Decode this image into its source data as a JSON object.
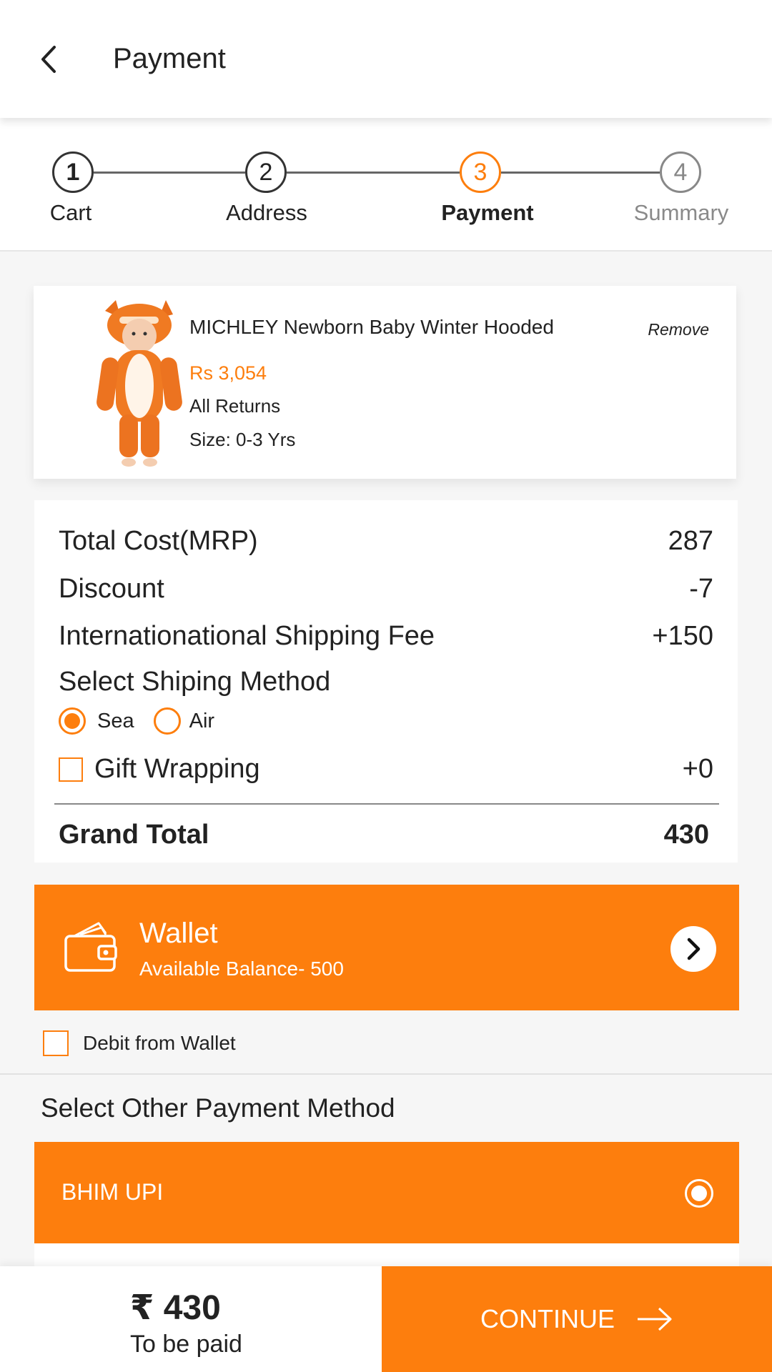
{
  "header": {
    "title": "Payment",
    "back_icon": "chevron-left-icon"
  },
  "stepper": {
    "steps": [
      {
        "number": "1",
        "label": "Cart",
        "state": "done"
      },
      {
        "number": "2",
        "label": "Address",
        "state": "done"
      },
      {
        "number": "3",
        "label": "Payment",
        "state": "active"
      },
      {
        "number": "4",
        "label": "Summary",
        "state": "future"
      }
    ]
  },
  "product": {
    "name": "MICHLEY Newborn Baby Winter Hooded",
    "remove_label": "Remove",
    "price": "Rs 3,054",
    "returns": "All Returns",
    "size": "Size: 0-3 Yrs"
  },
  "summary": {
    "total_label": "Total Cost(MRP)",
    "total_value": "287",
    "discount_label": "Discount",
    "discount_value": "-7",
    "shipping_label": "Internationational Shipping Fee",
    "shipping_value": "+150",
    "method_label": "Select Shiping Method",
    "method_options": [
      "Sea",
      "Air"
    ],
    "method_selected": "Sea",
    "gift_label": "Gift Wrapping",
    "gift_value": "+0",
    "gift_checked": false,
    "grand_label": "Grand Total",
    "grand_value": "430"
  },
  "wallet": {
    "title": "Wallet",
    "balance": "Available Balance- 500",
    "debit_label": "Debit from Wallet",
    "debit_checked": false
  },
  "other_payment": {
    "title": "Select Other Payment Method",
    "options": [
      {
        "label": "BHIM UPI",
        "selected": true
      }
    ]
  },
  "footer": {
    "amount": "₹ 430",
    "amount_label": "To be paid",
    "continue_label": "CONTINUE"
  },
  "colors": {
    "accent": "#fd7e0d",
    "text": "#222222"
  }
}
